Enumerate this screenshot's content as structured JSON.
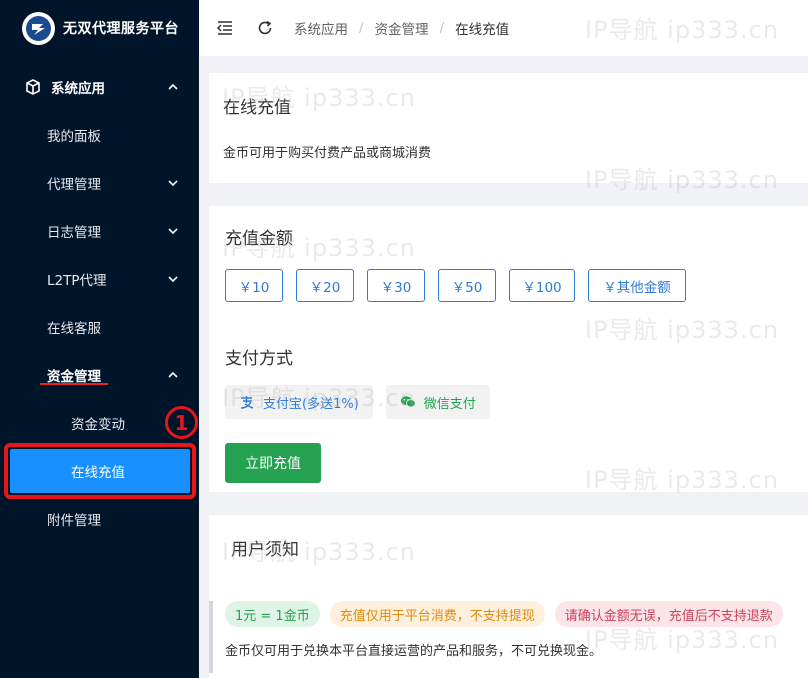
{
  "brand": {
    "title": "无双代理服务平台"
  },
  "sidebar": {
    "groups": [
      {
        "label": "系统应用"
      }
    ],
    "items": [
      {
        "label": "我的面板"
      },
      {
        "label": "代理管理"
      },
      {
        "label": "日志管理"
      },
      {
        "label": "L2TP代理"
      },
      {
        "label": "在线客服"
      },
      {
        "label": "资金管理"
      },
      {
        "label": "资金变动"
      },
      {
        "label": "在线充值"
      },
      {
        "label": "附件管理"
      }
    ],
    "annotation_number": "1"
  },
  "breadcrumb": [
    "系统应用",
    "资金管理",
    "在线充值"
  ],
  "breadcrumb_sep": "/",
  "watermark": {
    "text": "IP导航  ip333.cn"
  },
  "card1": {
    "title": "在线充值",
    "desc": "金币可用于购买付费产品或商城消费"
  },
  "recharge": {
    "amount_title": "充值金额",
    "amounts": [
      "￥10",
      "￥20",
      "￥30",
      "￥50",
      "￥100",
      "￥其他金额"
    ],
    "pay_title": "支付方式",
    "pay_methods": [
      "支付宝(多送1%)",
      "微信支付"
    ],
    "submit_label": "立即充值"
  },
  "notice": {
    "title": "用户须知",
    "tags": [
      "1元 = 1金币",
      "充值仅用于平台消费，不支持提现",
      "请确认金额无误，充值后不支持退款"
    ],
    "text": "金币仅可用于兑换本平台直接运营的产品和服务，不可兑换现金。"
  },
  "colors": {
    "sidebar_bg": "#001529",
    "accent": "#1890ff",
    "primary_blue": "#2f7bd6",
    "submit_green": "#25a152",
    "annotation_red": "#e5171a"
  },
  "icons": {
    "logo": "brand-logo-icon",
    "group": "cube-icon",
    "collapse": "menu-fold-icon",
    "refresh": "refresh-icon",
    "alipay": "alipay-icon",
    "wechat": "wechat-icon"
  }
}
